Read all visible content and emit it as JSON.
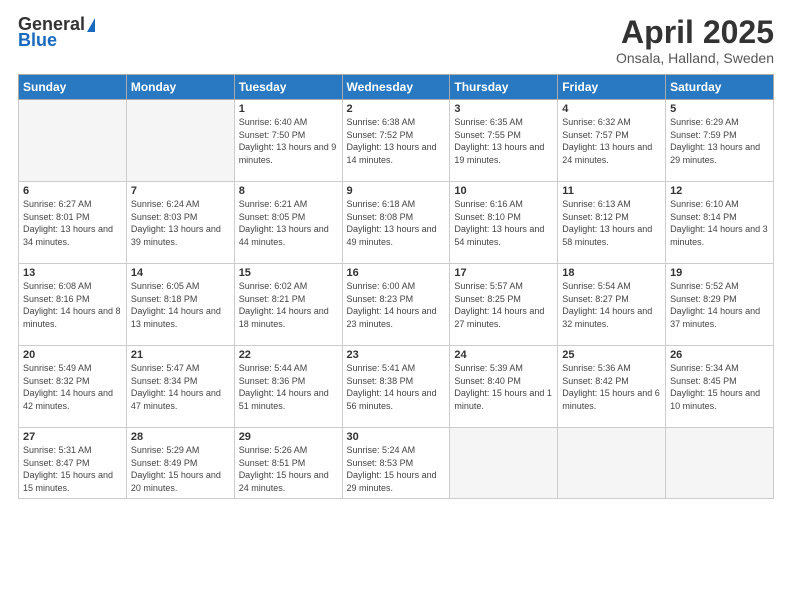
{
  "header": {
    "logo_general": "General",
    "logo_blue": "Blue",
    "month_title": "April 2025",
    "location": "Onsala, Halland, Sweden"
  },
  "weekdays": [
    "Sunday",
    "Monday",
    "Tuesday",
    "Wednesday",
    "Thursday",
    "Friday",
    "Saturday"
  ],
  "days": [
    {
      "date": 1,
      "sunrise": "6:40 AM",
      "sunset": "7:50 PM",
      "daylight": "13 hours and 9 minutes."
    },
    {
      "date": 2,
      "sunrise": "6:38 AM",
      "sunset": "7:52 PM",
      "daylight": "13 hours and 14 minutes."
    },
    {
      "date": 3,
      "sunrise": "6:35 AM",
      "sunset": "7:55 PM",
      "daylight": "13 hours and 19 minutes."
    },
    {
      "date": 4,
      "sunrise": "6:32 AM",
      "sunset": "7:57 PM",
      "daylight": "13 hours and 24 minutes."
    },
    {
      "date": 5,
      "sunrise": "6:29 AM",
      "sunset": "7:59 PM",
      "daylight": "13 hours and 29 minutes."
    },
    {
      "date": 6,
      "sunrise": "6:27 AM",
      "sunset": "8:01 PM",
      "daylight": "13 hours and 34 minutes."
    },
    {
      "date": 7,
      "sunrise": "6:24 AM",
      "sunset": "8:03 PM",
      "daylight": "13 hours and 39 minutes."
    },
    {
      "date": 8,
      "sunrise": "6:21 AM",
      "sunset": "8:05 PM",
      "daylight": "13 hours and 44 minutes."
    },
    {
      "date": 9,
      "sunrise": "6:18 AM",
      "sunset": "8:08 PM",
      "daylight": "13 hours and 49 minutes."
    },
    {
      "date": 10,
      "sunrise": "6:16 AM",
      "sunset": "8:10 PM",
      "daylight": "13 hours and 54 minutes."
    },
    {
      "date": 11,
      "sunrise": "6:13 AM",
      "sunset": "8:12 PM",
      "daylight": "13 hours and 58 minutes."
    },
    {
      "date": 12,
      "sunrise": "6:10 AM",
      "sunset": "8:14 PM",
      "daylight": "14 hours and 3 minutes."
    },
    {
      "date": 13,
      "sunrise": "6:08 AM",
      "sunset": "8:16 PM",
      "daylight": "14 hours and 8 minutes."
    },
    {
      "date": 14,
      "sunrise": "6:05 AM",
      "sunset": "8:18 PM",
      "daylight": "14 hours and 13 minutes."
    },
    {
      "date": 15,
      "sunrise": "6:02 AM",
      "sunset": "8:21 PM",
      "daylight": "14 hours and 18 minutes."
    },
    {
      "date": 16,
      "sunrise": "6:00 AM",
      "sunset": "8:23 PM",
      "daylight": "14 hours and 23 minutes."
    },
    {
      "date": 17,
      "sunrise": "5:57 AM",
      "sunset": "8:25 PM",
      "daylight": "14 hours and 27 minutes."
    },
    {
      "date": 18,
      "sunrise": "5:54 AM",
      "sunset": "8:27 PM",
      "daylight": "14 hours and 32 minutes."
    },
    {
      "date": 19,
      "sunrise": "5:52 AM",
      "sunset": "8:29 PM",
      "daylight": "14 hours and 37 minutes."
    },
    {
      "date": 20,
      "sunrise": "5:49 AM",
      "sunset": "8:32 PM",
      "daylight": "14 hours and 42 minutes."
    },
    {
      "date": 21,
      "sunrise": "5:47 AM",
      "sunset": "8:34 PM",
      "daylight": "14 hours and 47 minutes."
    },
    {
      "date": 22,
      "sunrise": "5:44 AM",
      "sunset": "8:36 PM",
      "daylight": "14 hours and 51 minutes."
    },
    {
      "date": 23,
      "sunrise": "5:41 AM",
      "sunset": "8:38 PM",
      "daylight": "14 hours and 56 minutes."
    },
    {
      "date": 24,
      "sunrise": "5:39 AM",
      "sunset": "8:40 PM",
      "daylight": "15 hours and 1 minute."
    },
    {
      "date": 25,
      "sunrise": "5:36 AM",
      "sunset": "8:42 PM",
      "daylight": "15 hours and 6 minutes."
    },
    {
      "date": 26,
      "sunrise": "5:34 AM",
      "sunset": "8:45 PM",
      "daylight": "15 hours and 10 minutes."
    },
    {
      "date": 27,
      "sunrise": "5:31 AM",
      "sunset": "8:47 PM",
      "daylight": "15 hours and 15 minutes."
    },
    {
      "date": 28,
      "sunrise": "5:29 AM",
      "sunset": "8:49 PM",
      "daylight": "15 hours and 20 minutes."
    },
    {
      "date": 29,
      "sunrise": "5:26 AM",
      "sunset": "8:51 PM",
      "daylight": "15 hours and 24 minutes."
    },
    {
      "date": 30,
      "sunrise": "5:24 AM",
      "sunset": "8:53 PM",
      "daylight": "15 hours and 29 minutes."
    }
  ]
}
